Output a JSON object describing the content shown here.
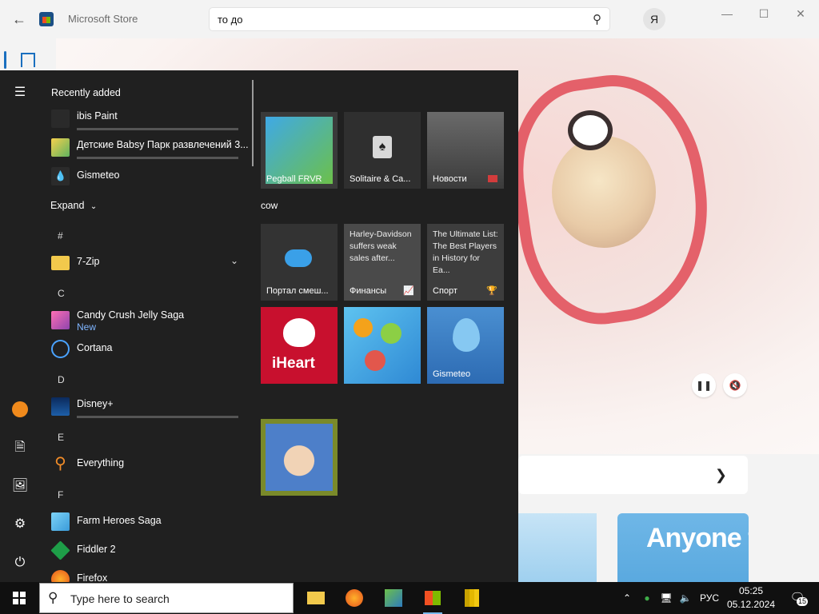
{
  "store": {
    "title": "Microsoft Store",
    "search_value": "то до",
    "controls": {
      "minimize": "—",
      "maximize": "☐",
      "close": "✕"
    },
    "promo_text": "Anyone f"
  },
  "start_menu": {
    "recently_added_title": "Recently added",
    "recent": [
      {
        "name": "ibis Paint"
      },
      {
        "name": "Детские Babsy Парк развлечений 3..."
      },
      {
        "name": "Gismeteo"
      }
    ],
    "expand_label": "Expand",
    "letters": {
      "hash": "#",
      "c": "C",
      "d": "D",
      "e": "E",
      "f": "F"
    },
    "apps": {
      "seven_zip": "7-Zip",
      "candy_crush": "Candy Crush Jelly Saga",
      "candy_crush_sub": "New",
      "cortana": "Cortana",
      "disney": "Disney+",
      "everything": "Everything",
      "farm_heroes": "Farm Heroes Saga",
      "fiddler": "Fiddler 2",
      "firefox": "Firefox"
    },
    "tiles": {
      "pegball": "Pegball FRVR",
      "solitaire": "Solitaire & Ca...",
      "news": "Новости",
      "group_label": "cow",
      "portal": "Портал смеш...",
      "finance_headline": "Harley-Davidson suffers weak sales after...",
      "finance": "Финансы",
      "sport_headline": "The Ultimate List: The Best Players in History for Ea...",
      "sport": "Спорт",
      "iheart": "iHeart",
      "gismeteo": "Gismeteo"
    }
  },
  "taskbar": {
    "search_placeholder": "Type here to search",
    "language": "РУС",
    "time": "05:25",
    "date": "05.12.2024",
    "notifications": "15"
  }
}
